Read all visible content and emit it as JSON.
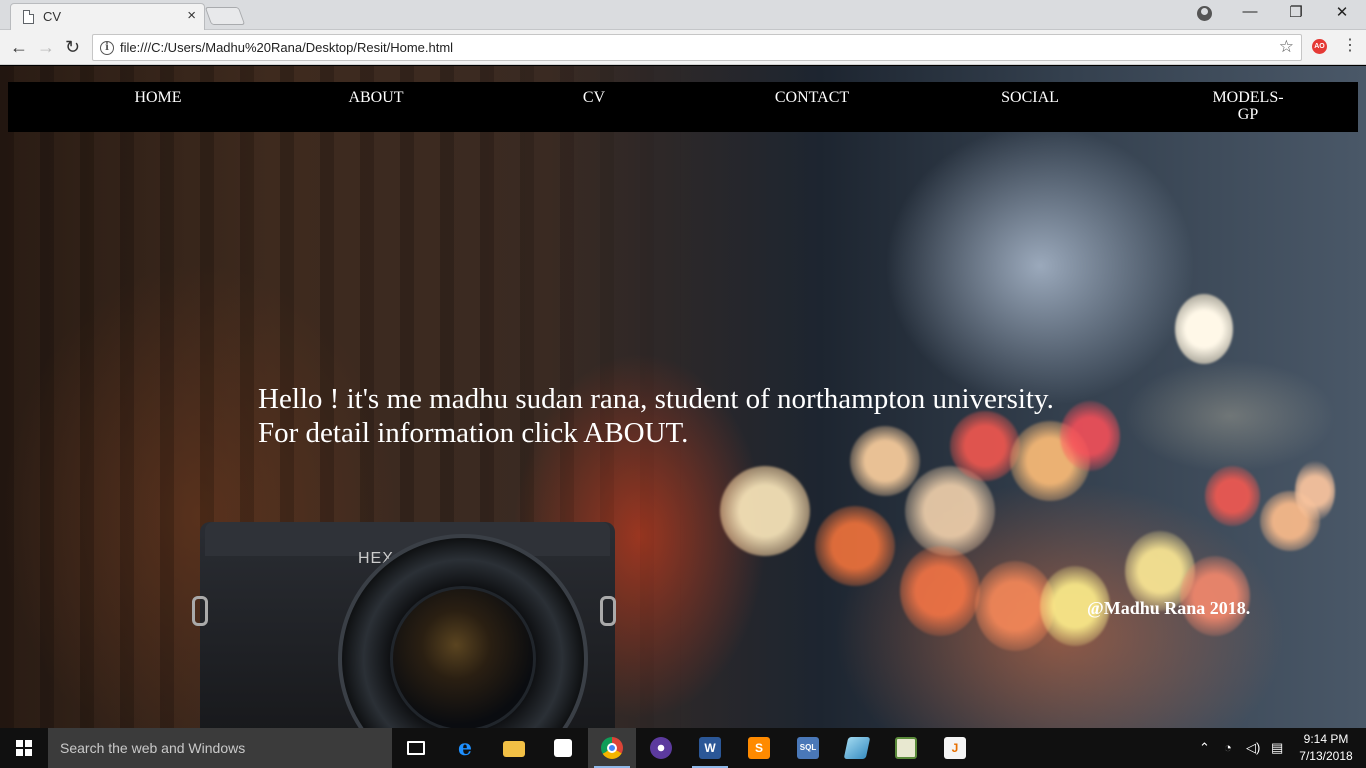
{
  "browser": {
    "tab_title": "CV",
    "tab_close": "×",
    "url": "file:///C:/Users/Madhu%20Rana/Desktop/Resit/Home.html",
    "ext_badge": "AO",
    "icons": [
      "page-icon",
      "profile-icon",
      "minimize-icon",
      "restore-icon",
      "close-icon",
      "back-icon",
      "forward-icon",
      "reload-icon",
      "info-icon",
      "star-icon",
      "menu-icon"
    ],
    "window_controls": {
      "minimize": "—",
      "restore": "❐",
      "close": "✕"
    },
    "nav": {
      "back": "←",
      "forward": "→",
      "reload": "↻",
      "star": "☆",
      "menu": "⋮",
      "info": "i"
    }
  },
  "site": {
    "nav": [
      "HOME",
      "ABOUT",
      "CV",
      "CONTACT",
      "SOCIAL",
      "MODELS-GP"
    ],
    "nav_models_line1": "MODELS-",
    "nav_models_line2": "GP",
    "hero_line1": "Hello ! it's me madhu sudan rana, student of northampton university.",
    "hero_line2": "For detail information click ABOUT.",
    "footer": "@Madhu Rana 2018.",
    "camera_brand": "HEX"
  },
  "taskbar": {
    "search_placeholder": "Search the web and Windows",
    "apps": [
      "task-view",
      "edge",
      "file-explorer",
      "store",
      "chrome",
      "eclipse",
      "word",
      "sublime-text",
      "sql-server",
      "paint-3d",
      "excel-chart",
      "java"
    ],
    "time": "9:14 PM",
    "date": "7/13/2018",
    "tray_icons": [
      "chevron-up-icon",
      "wifi-icon",
      "volume-icon",
      "notification-icon"
    ]
  },
  "colors": {
    "nav_bg": "#000000",
    "text": "#ffffff",
    "taskbar_bg": "#101010"
  }
}
